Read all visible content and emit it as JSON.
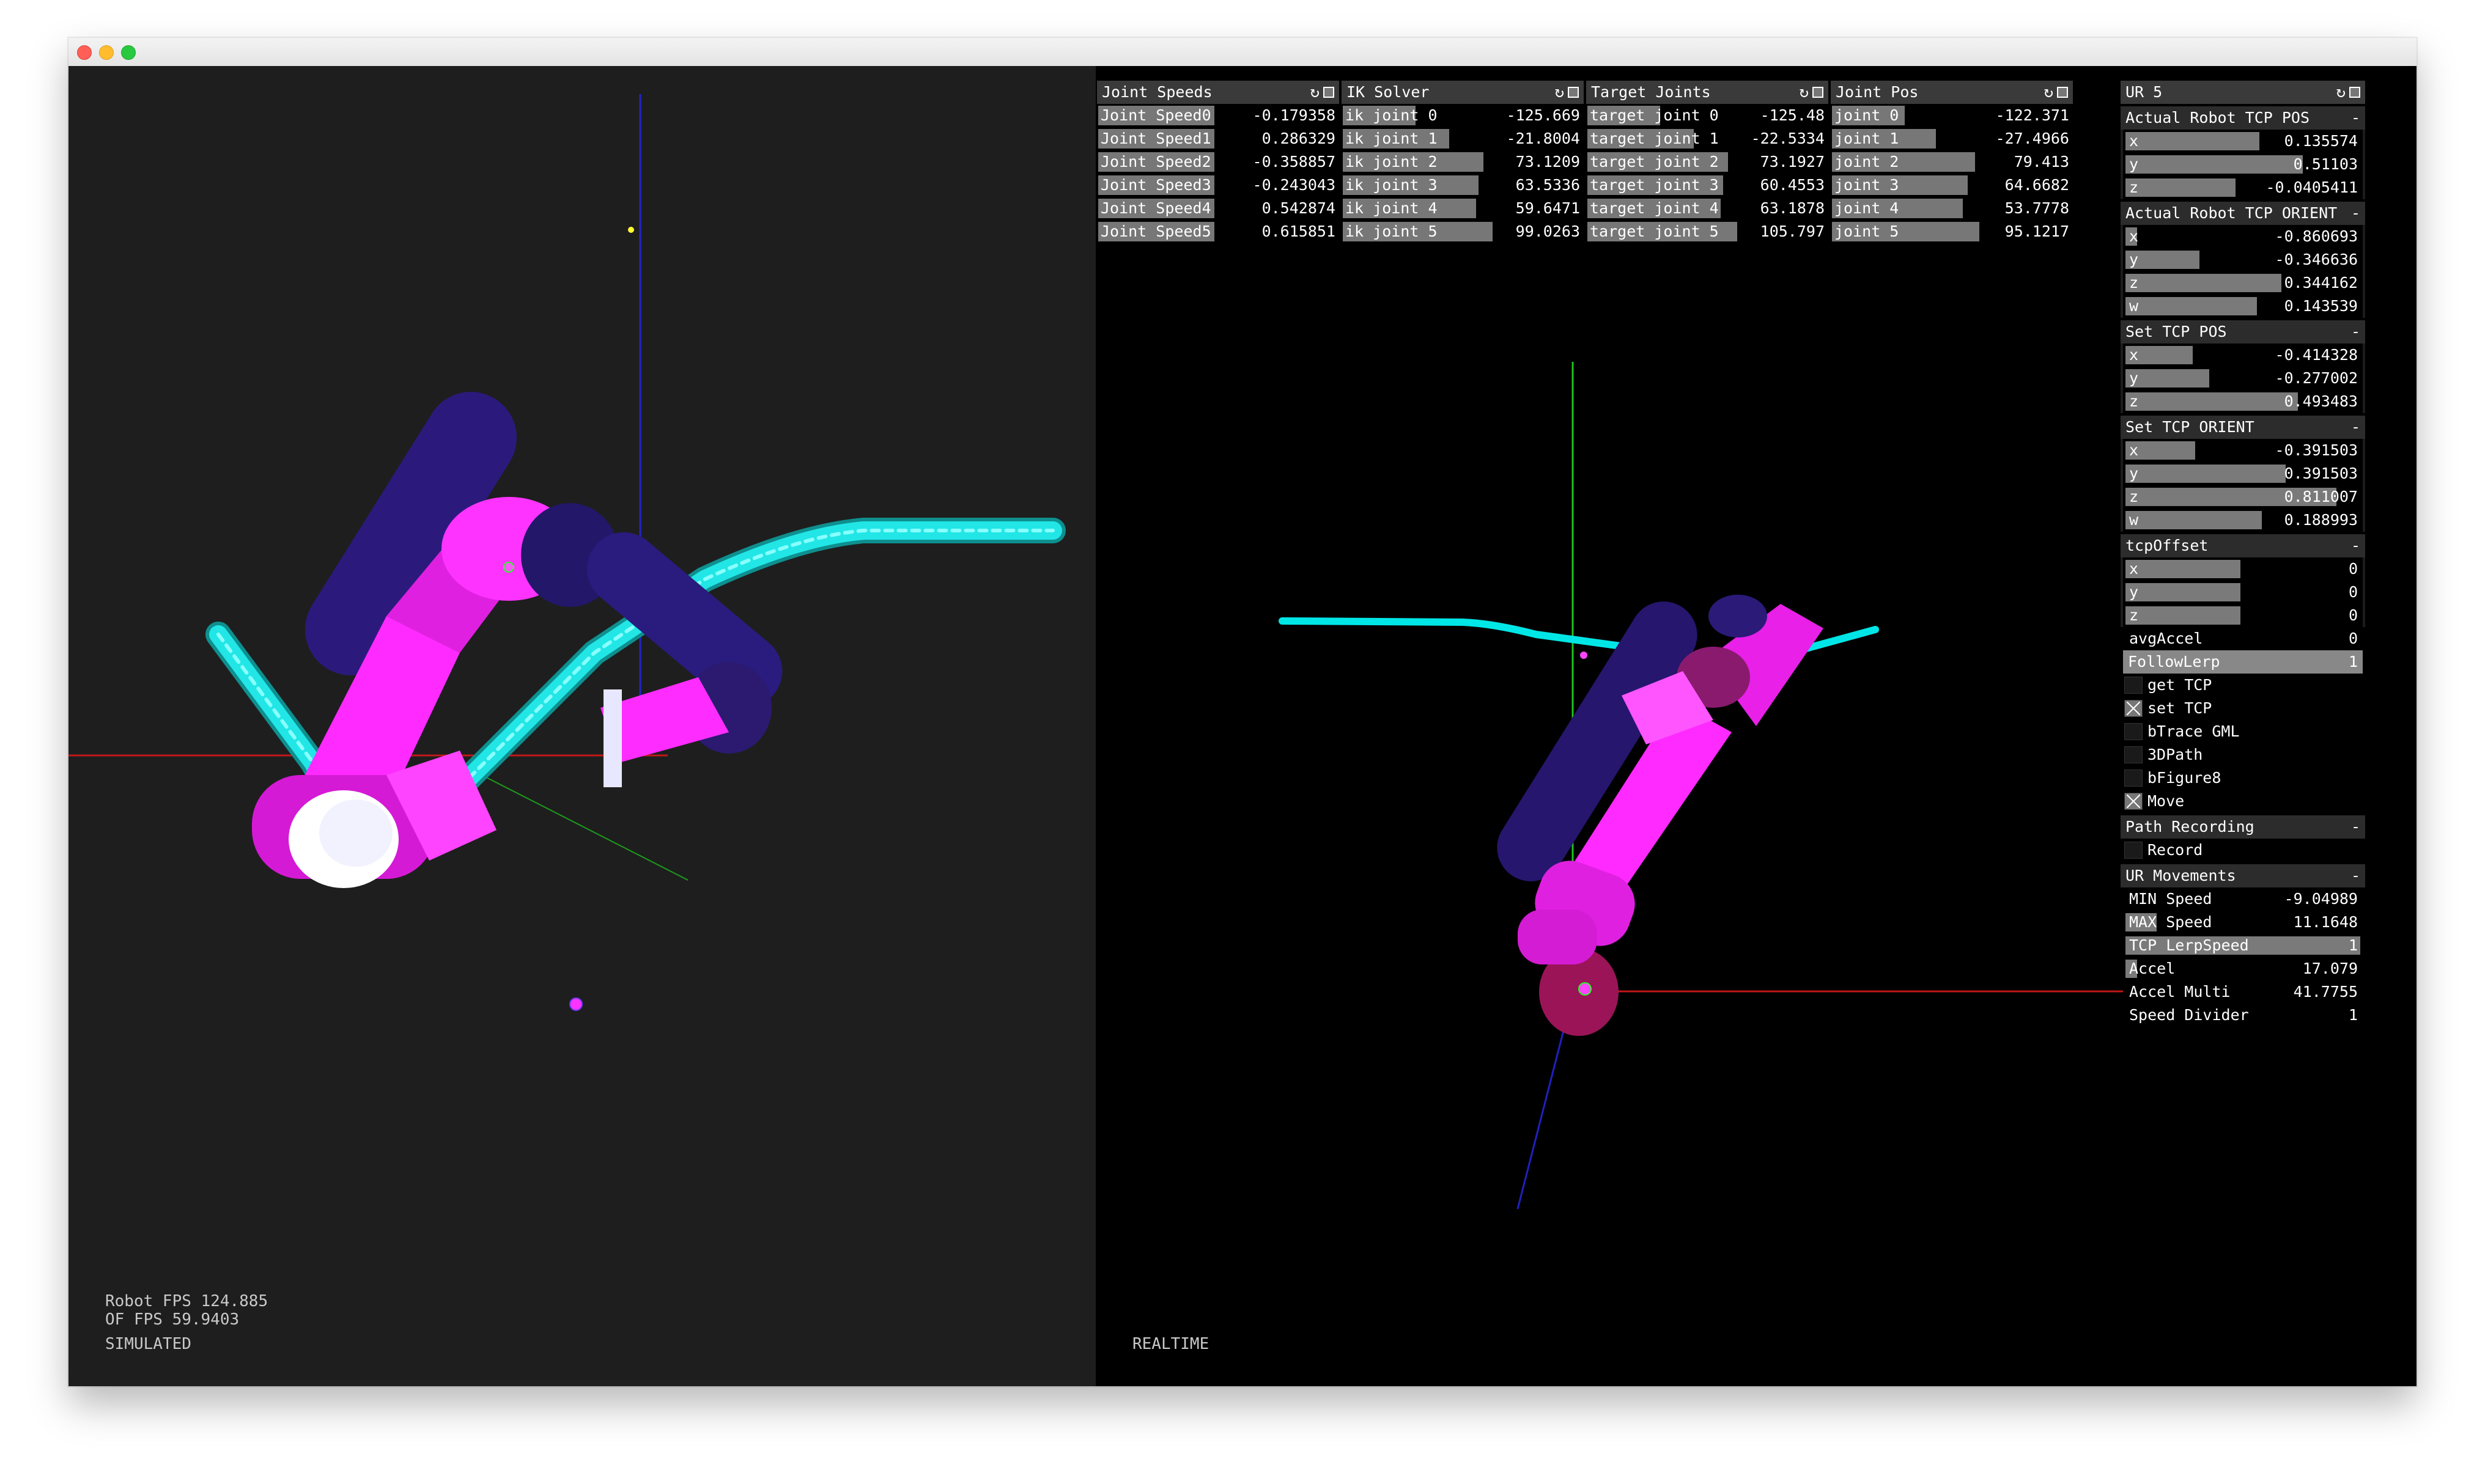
{
  "window": {
    "traffic_lights": [
      "close",
      "minimize",
      "maximize"
    ]
  },
  "left_view": {
    "robot_fps": "Robot FPS 124.885",
    "of_fps": "OF FPS 59.9403",
    "mode": "SIMULATED"
  },
  "right_view": {
    "mode": "REALTIME"
  },
  "panels": {
    "joint_speeds": {
      "title": "Joint Speeds",
      "rows": [
        {
          "label": "Joint Speed0",
          "value": "-0.179358",
          "fill": 0.5
        },
        {
          "label": "Joint Speed1",
          "value": "0.286329",
          "fill": 0.5
        },
        {
          "label": "Joint Speed2",
          "value": "-0.358857",
          "fill": 0.5
        },
        {
          "label": "Joint Speed3",
          "value": "-0.243043",
          "fill": 0.5
        },
        {
          "label": "Joint Speed4",
          "value": "0.542874",
          "fill": 0.5
        },
        {
          "label": "Joint Speed5",
          "value": "0.615851",
          "fill": 0.5
        }
      ]
    },
    "ik_solver": {
      "title": "IK Solver",
      "rows": [
        {
          "label": "ik joint 0",
          "value": "-125.669",
          "fill": 0.32
        },
        {
          "label": "ik joint 1",
          "value": "-21.8004",
          "fill": 0.46
        },
        {
          "label": "ik joint 2",
          "value": "73.1209",
          "fill": 0.6
        },
        {
          "label": "ik joint 3",
          "value": "63.5336",
          "fill": 0.58
        },
        {
          "label": "ik joint 4",
          "value": "59.6471",
          "fill": 0.57
        },
        {
          "label": "ik joint 5",
          "value": "99.0263",
          "fill": 0.64
        }
      ]
    },
    "target_joints": {
      "title": "Target Joints",
      "rows": [
        {
          "label": "target joint 0",
          "value": "-125.48",
          "fill": 0.32
        },
        {
          "label": "target joint 1",
          "value": "-22.5334",
          "fill": 0.46
        },
        {
          "label": "target joint 2",
          "value": "73.1927",
          "fill": 0.6
        },
        {
          "label": "target joint 3",
          "value": "60.4553",
          "fill": 0.58
        },
        {
          "label": "target joint 4",
          "value": "63.1878",
          "fill": 0.57
        },
        {
          "label": "target joint 5",
          "value": "105.797",
          "fill": 0.64
        }
      ]
    },
    "joint_pos": {
      "title": "Joint Pos",
      "rows": [
        {
          "label": "joint 0",
          "value": "-122.371",
          "fill": 0.32
        },
        {
          "label": "joint 1",
          "value": "-27.4966",
          "fill": 0.45
        },
        {
          "label": "joint 2",
          "value": "79.413",
          "fill": 0.61
        },
        {
          "label": "joint 3",
          "value": "64.6682",
          "fill": 0.58
        },
        {
          "label": "joint 4",
          "value": "53.7778",
          "fill": 0.56
        },
        {
          "label": "joint 5",
          "value": "95.1217",
          "fill": 0.63
        }
      ]
    }
  },
  "ur": {
    "title": "UR 5",
    "groups": [
      {
        "title": "Actual Robot TCP POS",
        "rows": [
          {
            "label": "x",
            "value": "0.135574",
            "fill": 0.58
          },
          {
            "label": "y",
            "value": "0.51103",
            "fill": 0.76
          },
          {
            "label": "z",
            "value": "-0.0405411",
            "fill": 0.48
          }
        ]
      },
      {
        "title": "Actual Robot TCP ORIENT",
        "rows": [
          {
            "label": "x",
            "value": "-0.860693",
            "fill": 0.07
          },
          {
            "label": "y",
            "value": "-0.346636",
            "fill": 0.33
          },
          {
            "label": "z",
            "value": "0.344162",
            "fill": 0.67
          },
          {
            "label": "w",
            "value": "0.143539",
            "fill": 0.57
          }
        ]
      },
      {
        "title": "Set TCP POS",
        "rows": [
          {
            "label": "x",
            "value": "-0.414328",
            "fill": 0.3
          },
          {
            "label": "y",
            "value": "-0.277002",
            "fill": 0.37
          },
          {
            "label": "z",
            "value": "0.493483",
            "fill": 0.74
          }
        ]
      },
      {
        "title": "Set TCP ORIENT",
        "rows": [
          {
            "label": "x",
            "value": "-0.391503",
            "fill": 0.31
          },
          {
            "label": "y",
            "value": "0.391503",
            "fill": 0.69
          },
          {
            "label": "z",
            "value": "0.811007",
            "fill": 0.9
          },
          {
            "label": "w",
            "value": "0.188993",
            "fill": 0.59
          }
        ]
      },
      {
        "title": "tcpOffset",
        "rows": [
          {
            "label": "x",
            "value": "0",
            "fill": 0.5
          },
          {
            "label": "y",
            "value": "0",
            "fill": 0.5
          },
          {
            "label": "z",
            "value": "0",
            "fill": 0.5
          }
        ]
      }
    ],
    "avg_accel": {
      "label": "avgAccel",
      "value": "0"
    },
    "follow_lerp": {
      "label": "FollowLerp",
      "value": "1"
    },
    "toggles": [
      {
        "label": "get TCP",
        "checked": false
      },
      {
        "label": "set TCP",
        "checked": true
      },
      {
        "label": "bTrace GML",
        "checked": false
      },
      {
        "label": "3DPath",
        "checked": false
      },
      {
        "label": "bFigure8",
        "checked": false
      },
      {
        "label": "Move",
        "checked": true
      }
    ],
    "path_recording": {
      "title": "Path Recording",
      "record_label": "Record"
    },
    "movements": {
      "title": "UR Movements",
      "rows": [
        {
          "label": "MIN Speed",
          "value": "-9.04989",
          "fill": 0.0
        },
        {
          "label": "MAX Speed",
          "value": "11.1648",
          "fill": 0.15
        },
        {
          "label": "TCP LerpSpeed",
          "value": "1",
          "fill": 1.0
        },
        {
          "label": "Accel",
          "value": "17.079",
          "fill": 0.07
        },
        {
          "label": "Accel Multi",
          "value": "41.7755",
          "fill": 0.02
        },
        {
          "label": "Speed Divider",
          "value": "1",
          "fill": 0.0
        }
      ]
    },
    "collapse_symbol": "-"
  },
  "colors": {
    "sim_bg": "#1e1e1e",
    "real_bg": "#000000",
    "path": "#19e0e0",
    "robot_main": "#ff22ff",
    "robot_dark": "#2a1a7a",
    "axis_x": "#d42020",
    "axis_y": "#20d020",
    "axis_z": "#2020c0"
  }
}
